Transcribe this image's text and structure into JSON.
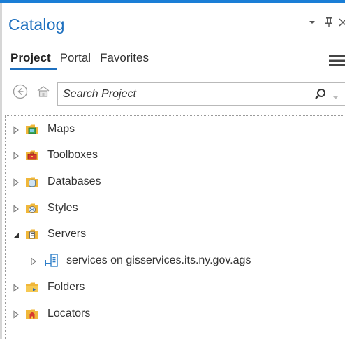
{
  "pane": {
    "title": "Catalog",
    "accent": "#1e70bf",
    "controls": [
      "dropdown-arrow-icon",
      "pin-icon",
      "close-icon"
    ]
  },
  "tabs": [
    {
      "label": "Project",
      "active": true
    },
    {
      "label": "Portal",
      "active": false
    },
    {
      "label": "Favorites",
      "active": false
    }
  ],
  "search": {
    "placeholder": "Search Project",
    "value": ""
  },
  "tree": {
    "items": [
      {
        "label": "Maps",
        "icon": "maps-folder-icon",
        "state": "collapsed"
      },
      {
        "label": "Toolboxes",
        "icon": "toolboxes-folder-icon",
        "state": "collapsed"
      },
      {
        "label": "Databases",
        "icon": "databases-folder-icon",
        "state": "collapsed"
      },
      {
        "label": "Styles",
        "icon": "styles-folder-icon",
        "state": "collapsed"
      },
      {
        "label": "Servers",
        "icon": "servers-folder-icon",
        "state": "expanded"
      },
      {
        "label": "services on gisservices.its.ny.gov.ags",
        "icon": "server-connection-icon",
        "state": "collapsed",
        "child_of": "Servers"
      },
      {
        "label": "Folders",
        "icon": "folders-icon",
        "state": "collapsed"
      },
      {
        "label": "Locators",
        "icon": "locators-folder-icon",
        "state": "collapsed"
      }
    ]
  }
}
